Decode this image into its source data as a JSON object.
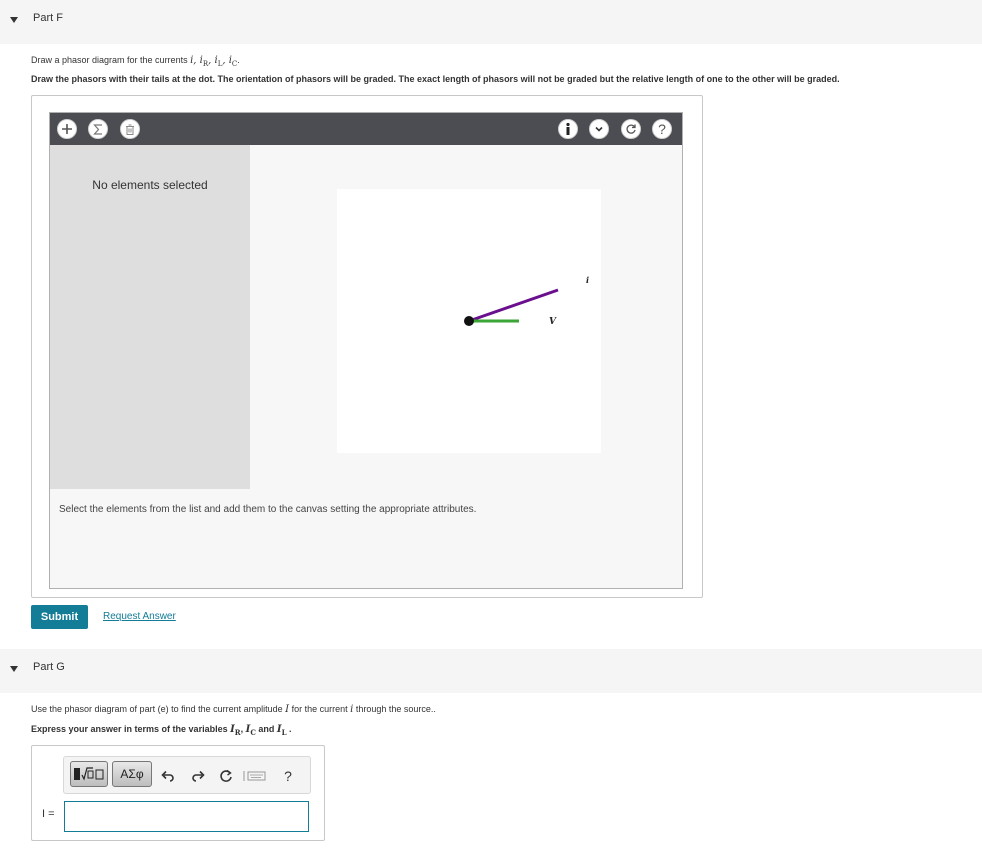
{
  "partF": {
    "title": "Part F",
    "instruction1_prefix": "Draw a phasor diagram for the currents ",
    "instruction1_vars": "i, i",
    "sub_R": "R",
    "sub_L": "L",
    "sub_C": "C",
    "instruction2": "Draw the phasors with their tails at the dot. The orientation of phasors will be graded. The exact length of phasors will not be graded but the relative length of one to the other will be graded.",
    "toolbar": {
      "add_icon": "plus-icon",
      "sum_icon": "sigma-icon",
      "delete_icon": "trash-icon",
      "info_icon": "info-icon",
      "dropdown_icon": "chevron-down-icon",
      "reset_icon": "reset-icon",
      "help_icon": "help-icon"
    },
    "no_selection": "No elements selected",
    "canvas": {
      "label_v": "V",
      "label_i": "i"
    },
    "hint": "Select the elements from the list and add them to the canvas setting the appropriate attributes.",
    "submit_label": "Submit",
    "request_label": "Request Answer"
  },
  "partG": {
    "title": "Part G",
    "instruction1_prefix": "Use the phasor diagram of part (e) to find the current amplitude ",
    "instruction1_var": "I",
    "instruction1_mid": " for the current ",
    "instruction1_var2": "i",
    "instruction1_suffix": " through the source..",
    "instruction2_prefix": "Express your answer in terms of the variables ",
    "var_I": "I",
    "sub_R": "R",
    "sub_C": "C",
    "sub_L": "L",
    "comma": ",",
    "and": " and ",
    "period": ".",
    "equation_toolbar": {
      "greek_label": "ΑΣφ",
      "help_label": "?"
    },
    "answer_label": "I =",
    "answer_value": ""
  },
  "colors": {
    "accent": "#137c96",
    "toolbar_bg": "#4b4d53",
    "phasor_i": "#6a0f8e",
    "phasor_v": "#3aa635"
  }
}
